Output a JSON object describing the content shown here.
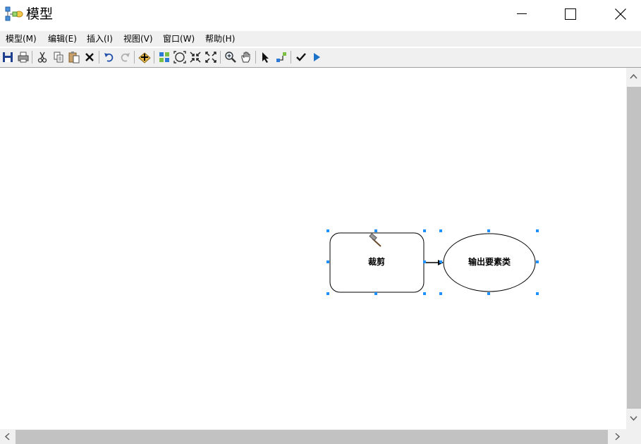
{
  "window": {
    "title": "模型"
  },
  "menu": [
    {
      "label": "模型(M)"
    },
    {
      "label": "编辑(E)"
    },
    {
      "label": "插入(I)"
    },
    {
      "label": "视图(V)"
    },
    {
      "label": "窗口(W)"
    },
    {
      "label": "帮助(H)"
    }
  ],
  "toolbar": {
    "buttons": [
      "save-icon",
      "print-icon",
      "cut-icon",
      "copy-icon",
      "paste-icon",
      "delete-icon",
      "undo-icon",
      "redo-icon",
      "add-data-icon",
      "auto-layout-icon",
      "full-extent-icon",
      "zoom-in-fixed-icon",
      "zoom-out-fixed-icon",
      "zoom-in-icon",
      "pan-icon",
      "select-icon",
      "connect-icon",
      "validate-icon",
      "run-icon"
    ]
  },
  "model": {
    "tool_node": {
      "label": "裁剪",
      "icon": "hammer-icon"
    },
    "output_node": {
      "label": "输出要素类"
    }
  },
  "colors": {
    "selection_handle": "#1e90ff",
    "accent_blue": "#1a73c9"
  }
}
